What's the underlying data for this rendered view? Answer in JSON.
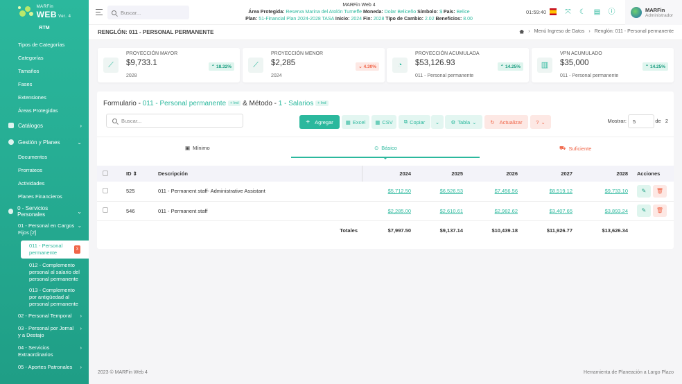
{
  "sidebar": {
    "brand": "MARFin",
    "brand_web": "WEB",
    "brand_ver": "Ver. 4",
    "rtm": "RTM",
    "subitems": [
      "Tipos de Categorías",
      "Categorías",
      "Tamaños",
      "Fases",
      "Extensiones",
      "Áreas Protegidas"
    ],
    "catalogos": "Catálogos",
    "gestion": "Gestión y Planes",
    "gestion_items": [
      "Documentos",
      "Prorrateos",
      "Actividades",
      "Planes Financieros"
    ],
    "servicios": "0 - Servicios Personales",
    "group1": "01 - Personal en Cargos Fijos [2]",
    "active_item": "011 - Personal permanente",
    "active_badge": "3",
    "children": [
      "012 - Complemento personal al salario del personal permanente",
      "013 - Complemento por antigüedad al personal permanente"
    ],
    "groups": [
      "02 - Personal Temporal",
      "03 - Personal por Jornal y a Destajo",
      "04 - Servicios Extraordinarios",
      "05 - Aportes Patronales"
    ]
  },
  "topbar": {
    "search_placeholder": "Buscar...",
    "app_name": "MARFin Web 4",
    "area_label": "Área Protegida:",
    "area_value": "Reserva Marina del Atolón Turneffe",
    "moneda_label": "Moneda:",
    "moneda_value": "Dolar Beliceño",
    "simbolo_label": "Símbolo:",
    "simbolo_value": "$",
    "pais_label": "País:",
    "pais_value": "Belice",
    "plan_label": "Plan:",
    "plan_value": "51-Financial Plan 2024-2028 TASA",
    "inicio_label": "Inicio:",
    "inicio_value": "2024",
    "fin_label": "Fin:",
    "fin_value": "2028",
    "tc_label": "Tipo de Cambio:",
    "tc_value": "2.02",
    "ben_label": "Beneficios:",
    "ben_value": "8.00",
    "clock": "01:59:40",
    "user_name": "MARFin",
    "user_role": "Administrador"
  },
  "page": {
    "title": "RENGLÓN: 011 - PERSONAL PERMANENTE",
    "crumb_1": "Menú Ingreso de Datos",
    "crumb_2": "Renglón: 011 - Personal permanente"
  },
  "cards": [
    {
      "label": "Proyección Mayor",
      "value": "$9,733.1",
      "sub": "2028",
      "pct": "18.32%",
      "trend": "up",
      "icon": "line-chart-icon"
    },
    {
      "label": "Proyección Menor",
      "value": "$2,285",
      "sub": "2024",
      "pct": "4.30%",
      "trend": "down",
      "icon": "line-chart-icon"
    },
    {
      "label": "Proyección Acumulada",
      "value": "$53,126.93",
      "sub": "011 - Personal permanente",
      "pct": "14.25%",
      "trend": "up",
      "icon": "pie-chart-icon"
    },
    {
      "label": "VPN Acumulado",
      "value": "$35,000",
      "sub": "011 - Personal permanente",
      "pct": "14.25%",
      "trend": "up",
      "icon": "bar-chart-icon"
    }
  ],
  "form": {
    "label": "Formulario -",
    "form_value": "011 - Personal permanente",
    "tag": "+ Ind",
    "method_label": "& Método -",
    "method_value": "1 - Salarios",
    "search_placeholder": "Buscar...",
    "btn_add": "Agregar",
    "btn_excel": "Excel",
    "btn_csv": "CSV",
    "btn_copy": "Copiar",
    "btn_table": "Tabla",
    "btn_update": "Actualizar",
    "btn_help": "?",
    "show_label": "Mostrar:",
    "show_value": "5",
    "of_label": "de",
    "of_value": "2"
  },
  "tabs": [
    "Mínimo",
    "Básico",
    "Suficiente"
  ],
  "table": {
    "headers": [
      "ID",
      "Descripción",
      "2024",
      "2025",
      "2026",
      "2027",
      "2028",
      "Acciones"
    ],
    "rows": [
      {
        "id": "525",
        "desc": "011 - Permanent staff- Administrative Assistant",
        "v": [
          "$5,712.50",
          "$6,526.53",
          "$7,456.56",
          "$8,519.12",
          "$9,733.10"
        ]
      },
      {
        "id": "546",
        "desc": "011 - Permanent staff",
        "v": [
          "$2,285.00",
          "$2,610.61",
          "$2,982.62",
          "$3,407.65",
          "$3,893.24"
        ]
      }
    ],
    "totals_label": "Totales",
    "totals": [
      "$7,997.50",
      "$9,137.14",
      "$10,439.18",
      "$11,926.77",
      "$13,626.34"
    ]
  },
  "footer": {
    "left": "2023 © MARFin Web 4",
    "right": "Herramienta de Planeación a Largo Plazo"
  }
}
